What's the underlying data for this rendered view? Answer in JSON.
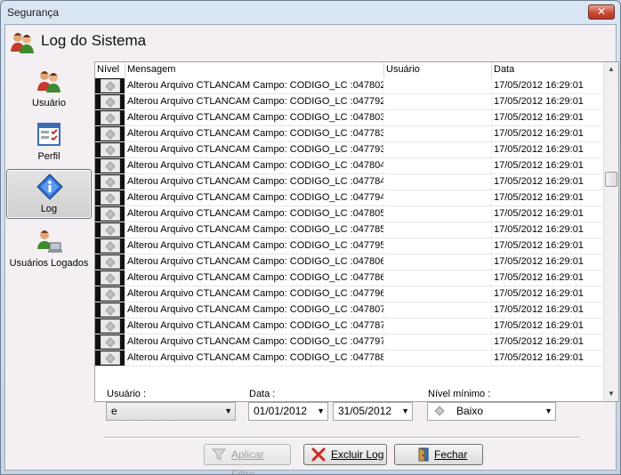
{
  "window": {
    "title": "Segurança",
    "close_glyph": "✕"
  },
  "header": {
    "title": "Log do Sistema",
    "icon": "users-icon"
  },
  "sidebar": {
    "items": [
      {
        "label": "Usuário",
        "icon": "users-icon",
        "active": false
      },
      {
        "label": "Perfil",
        "icon": "profile-checklist-icon",
        "active": false
      },
      {
        "label": "Log",
        "icon": "info-diamond-icon",
        "active": true
      },
      {
        "label": "Usuários Logados",
        "icon": "users-computer-icon",
        "active": false
      }
    ]
  },
  "grid": {
    "columns": [
      "Nível",
      "Mensagem",
      "Usuário",
      "Data"
    ],
    "rows": [
      {
        "mensagem": "Alterou Arquivo CTLANCAM Campo: CODIGO_LC :047802",
        "usuario": "",
        "data": "17/05/2012 16:29:01"
      },
      {
        "mensagem": "Alterou Arquivo CTLANCAM Campo: CODIGO_LC :047792",
        "usuario": "",
        "data": "17/05/2012 16:29:01"
      },
      {
        "mensagem": "Alterou Arquivo CTLANCAM Campo: CODIGO_LC :047803",
        "usuario": "",
        "data": "17/05/2012 16:29:01"
      },
      {
        "mensagem": "Alterou Arquivo CTLANCAM Campo: CODIGO_LC :047783",
        "usuario": "",
        "data": "17/05/2012 16:29:01"
      },
      {
        "mensagem": "Alterou Arquivo CTLANCAM Campo: CODIGO_LC :047793",
        "usuario": "",
        "data": "17/05/2012 16:29:01"
      },
      {
        "mensagem": "Alterou Arquivo CTLANCAM Campo: CODIGO_LC :047804",
        "usuario": "",
        "data": "17/05/2012 16:29:01"
      },
      {
        "mensagem": "Alterou Arquivo CTLANCAM Campo: CODIGO_LC :047784",
        "usuario": "",
        "data": "17/05/2012 16:29:01"
      },
      {
        "mensagem": "Alterou Arquivo CTLANCAM Campo: CODIGO_LC :047794",
        "usuario": "",
        "data": "17/05/2012 16:29:01"
      },
      {
        "mensagem": "Alterou Arquivo CTLANCAM Campo: CODIGO_LC :047805",
        "usuario": "",
        "data": "17/05/2012 16:29:01"
      },
      {
        "mensagem": "Alterou Arquivo CTLANCAM Campo: CODIGO_LC :047785",
        "usuario": "",
        "data": "17/05/2012 16:29:01"
      },
      {
        "mensagem": "Alterou Arquivo CTLANCAM Campo: CODIGO_LC :047795",
        "usuario": "",
        "data": "17/05/2012 16:29:01"
      },
      {
        "mensagem": "Alterou Arquivo CTLANCAM Campo: CODIGO_LC :047806",
        "usuario": "",
        "data": "17/05/2012 16:29:01"
      },
      {
        "mensagem": "Alterou Arquivo CTLANCAM Campo: CODIGO_LC :047786",
        "usuario": "",
        "data": "17/05/2012 16:29:01"
      },
      {
        "mensagem": "Alterou Arquivo CTLANCAM Campo: CODIGO_LC :047796",
        "usuario": "",
        "data": "17/05/2012 16:29:01"
      },
      {
        "mensagem": "Alterou Arquivo CTLANCAM Campo: CODIGO_LC :047807",
        "usuario": "",
        "data": "17/05/2012 16:29:01"
      },
      {
        "mensagem": "Alterou Arquivo CTLANCAM Campo: CODIGO_LC :047787",
        "usuario": "",
        "data": "17/05/2012 16:29:01"
      },
      {
        "mensagem": "Alterou Arquivo CTLANCAM Campo: CODIGO_LC :047797",
        "usuario": "",
        "data": "17/05/2012 16:29:01"
      },
      {
        "mensagem": "Alterou Arquivo CTLANCAM Campo: CODIGO_LC :047788",
        "usuario": "",
        "data": "17/05/2012 16:29:01"
      }
    ],
    "scroll": {
      "up": "▲",
      "down": "▼"
    }
  },
  "filters": {
    "usuario_label": "Usuário :",
    "usuario_value": "e",
    "data_label": "Data :",
    "data_inicio": "01/01/2012",
    "data_fim": "31/05/2012",
    "nivel_label": "Nível mínimo :",
    "nivel_value": "Baixo",
    "dropdown_glyph": "▼"
  },
  "buttons": {
    "aplicar": "Aplicar Filtro",
    "excluir": "Excluir Log",
    "fechar": "Fechar"
  }
}
